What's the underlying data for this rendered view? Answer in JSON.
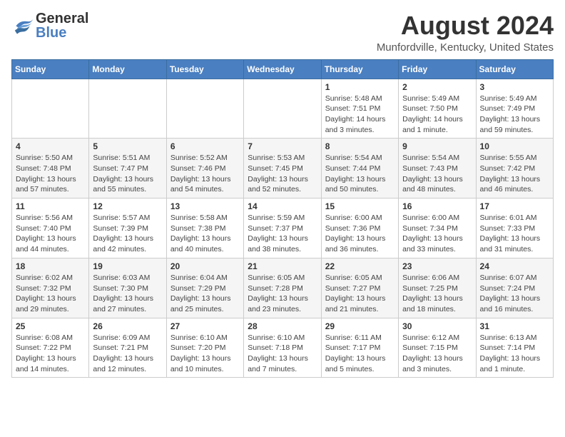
{
  "header": {
    "logo_line1": "General",
    "logo_line2": "Blue",
    "title": "August 2024",
    "subtitle": "Munfordville, Kentucky, United States"
  },
  "calendar": {
    "days_of_week": [
      "Sunday",
      "Monday",
      "Tuesday",
      "Wednesday",
      "Thursday",
      "Friday",
      "Saturday"
    ],
    "weeks": [
      {
        "days": [
          {
            "number": "",
            "info": ""
          },
          {
            "number": "",
            "info": ""
          },
          {
            "number": "",
            "info": ""
          },
          {
            "number": "",
            "info": ""
          },
          {
            "number": "1",
            "info": "Sunrise: 5:48 AM\nSunset: 7:51 PM\nDaylight: 14 hours\nand 3 minutes."
          },
          {
            "number": "2",
            "info": "Sunrise: 5:49 AM\nSunset: 7:50 PM\nDaylight: 14 hours\nand 1 minute."
          },
          {
            "number": "3",
            "info": "Sunrise: 5:49 AM\nSunset: 7:49 PM\nDaylight: 13 hours\nand 59 minutes."
          }
        ]
      },
      {
        "days": [
          {
            "number": "4",
            "info": "Sunrise: 5:50 AM\nSunset: 7:48 PM\nDaylight: 13 hours\nand 57 minutes."
          },
          {
            "number": "5",
            "info": "Sunrise: 5:51 AM\nSunset: 7:47 PM\nDaylight: 13 hours\nand 55 minutes."
          },
          {
            "number": "6",
            "info": "Sunrise: 5:52 AM\nSunset: 7:46 PM\nDaylight: 13 hours\nand 54 minutes."
          },
          {
            "number": "7",
            "info": "Sunrise: 5:53 AM\nSunset: 7:45 PM\nDaylight: 13 hours\nand 52 minutes."
          },
          {
            "number": "8",
            "info": "Sunrise: 5:54 AM\nSunset: 7:44 PM\nDaylight: 13 hours\nand 50 minutes."
          },
          {
            "number": "9",
            "info": "Sunrise: 5:54 AM\nSunset: 7:43 PM\nDaylight: 13 hours\nand 48 minutes."
          },
          {
            "number": "10",
            "info": "Sunrise: 5:55 AM\nSunset: 7:42 PM\nDaylight: 13 hours\nand 46 minutes."
          }
        ]
      },
      {
        "days": [
          {
            "number": "11",
            "info": "Sunrise: 5:56 AM\nSunset: 7:40 PM\nDaylight: 13 hours\nand 44 minutes."
          },
          {
            "number": "12",
            "info": "Sunrise: 5:57 AM\nSunset: 7:39 PM\nDaylight: 13 hours\nand 42 minutes."
          },
          {
            "number": "13",
            "info": "Sunrise: 5:58 AM\nSunset: 7:38 PM\nDaylight: 13 hours\nand 40 minutes."
          },
          {
            "number": "14",
            "info": "Sunrise: 5:59 AM\nSunset: 7:37 PM\nDaylight: 13 hours\nand 38 minutes."
          },
          {
            "number": "15",
            "info": "Sunrise: 6:00 AM\nSunset: 7:36 PM\nDaylight: 13 hours\nand 36 minutes."
          },
          {
            "number": "16",
            "info": "Sunrise: 6:00 AM\nSunset: 7:34 PM\nDaylight: 13 hours\nand 33 minutes."
          },
          {
            "number": "17",
            "info": "Sunrise: 6:01 AM\nSunset: 7:33 PM\nDaylight: 13 hours\nand 31 minutes."
          }
        ]
      },
      {
        "days": [
          {
            "number": "18",
            "info": "Sunrise: 6:02 AM\nSunset: 7:32 PM\nDaylight: 13 hours\nand 29 minutes."
          },
          {
            "number": "19",
            "info": "Sunrise: 6:03 AM\nSunset: 7:30 PM\nDaylight: 13 hours\nand 27 minutes."
          },
          {
            "number": "20",
            "info": "Sunrise: 6:04 AM\nSunset: 7:29 PM\nDaylight: 13 hours\nand 25 minutes."
          },
          {
            "number": "21",
            "info": "Sunrise: 6:05 AM\nSunset: 7:28 PM\nDaylight: 13 hours\nand 23 minutes."
          },
          {
            "number": "22",
            "info": "Sunrise: 6:05 AM\nSunset: 7:27 PM\nDaylight: 13 hours\nand 21 minutes."
          },
          {
            "number": "23",
            "info": "Sunrise: 6:06 AM\nSunset: 7:25 PM\nDaylight: 13 hours\nand 18 minutes."
          },
          {
            "number": "24",
            "info": "Sunrise: 6:07 AM\nSunset: 7:24 PM\nDaylight: 13 hours\nand 16 minutes."
          }
        ]
      },
      {
        "days": [
          {
            "number": "25",
            "info": "Sunrise: 6:08 AM\nSunset: 7:22 PM\nDaylight: 13 hours\nand 14 minutes."
          },
          {
            "number": "26",
            "info": "Sunrise: 6:09 AM\nSunset: 7:21 PM\nDaylight: 13 hours\nand 12 minutes."
          },
          {
            "number": "27",
            "info": "Sunrise: 6:10 AM\nSunset: 7:20 PM\nDaylight: 13 hours\nand 10 minutes."
          },
          {
            "number": "28",
            "info": "Sunrise: 6:10 AM\nSunset: 7:18 PM\nDaylight: 13 hours\nand 7 minutes."
          },
          {
            "number": "29",
            "info": "Sunrise: 6:11 AM\nSunset: 7:17 PM\nDaylight: 13 hours\nand 5 minutes."
          },
          {
            "number": "30",
            "info": "Sunrise: 6:12 AM\nSunset: 7:15 PM\nDaylight: 13 hours\nand 3 minutes."
          },
          {
            "number": "31",
            "info": "Sunrise: 6:13 AM\nSunset: 7:14 PM\nDaylight: 13 hours\nand 1 minute."
          }
        ]
      }
    ]
  }
}
